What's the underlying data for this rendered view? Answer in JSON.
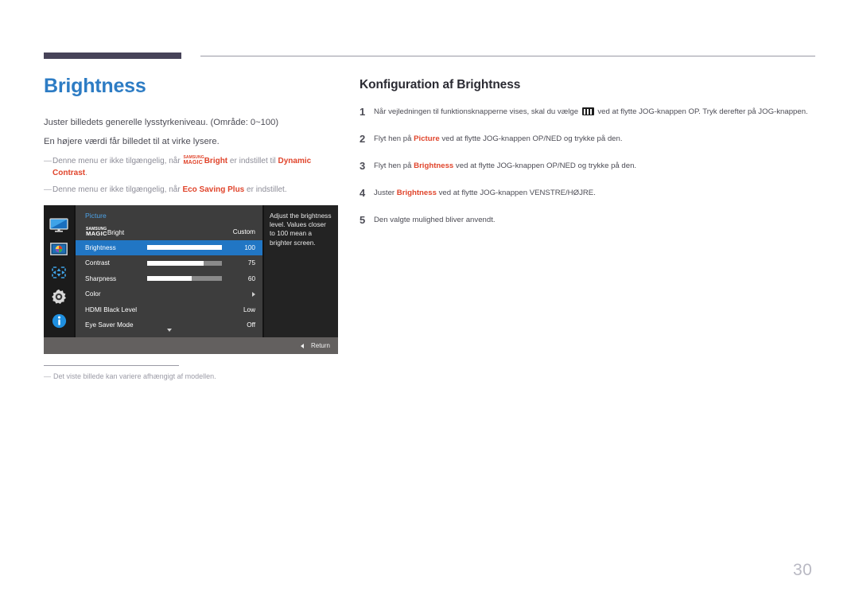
{
  "page": {
    "number": "30"
  },
  "left": {
    "title": "Brightness",
    "intro_lines": [
      "Juster billedets generelle lysstyrkeniveau. (Område: 0~100)",
      "En højere værdi får billedet til at virke lysere."
    ],
    "notes": [
      {
        "dash": "―",
        "prefix": "Denne menu er ikke tilgængelig, når ",
        "logo_line1": "SAMSUNG",
        "logo_line2": "MAGIC",
        "logo_suffix": "Bright",
        "middle": " er indstillet til ",
        "keyword": "Dynamic Contrast",
        "suffix": "."
      },
      {
        "dash": "―",
        "prefix": "Denne menu er ikke tilgængelig, når ",
        "keyword": "Eco Saving Plus",
        "suffix": " er indstillet."
      }
    ],
    "footnote": {
      "dash": "―",
      "text": "Det viste billede kan variere afhængigt af modellen."
    }
  },
  "osd": {
    "panel_title": "Picture",
    "sidebar_icons": [
      "monitor-icon",
      "picture-icon",
      "move-arrows-icon",
      "gear-icon",
      "info-icon"
    ],
    "rows": [
      {
        "label_logo_line1": "SAMSUNG",
        "label_logo_line2": "MAGIC",
        "label": "Bright",
        "value": "Custom",
        "type": "value",
        "selected": false
      },
      {
        "label": "Brightness",
        "value": "100",
        "type": "slider",
        "fill": 100,
        "selected": true
      },
      {
        "label": "Contrast",
        "value": "75",
        "type": "slider",
        "fill": 75,
        "selected": false
      },
      {
        "label": "Sharpness",
        "value": "60",
        "type": "slider",
        "fill": 60,
        "selected": false
      },
      {
        "label": "Color",
        "value": "",
        "type": "submenu",
        "selected": false
      },
      {
        "label": "HDMI Black Level",
        "value": "Low",
        "type": "value",
        "selected": false
      },
      {
        "label": "Eye Saver Mode",
        "value": "Off",
        "type": "value",
        "selected": false
      }
    ],
    "help_text": "Adjust the brightness level. Values closer to 100 mean a brighter screen.",
    "return_label": "Return"
  },
  "right": {
    "section_title": "Konfiguration af Brightness",
    "steps": [
      {
        "num": "1",
        "part1": "Når vejledningen til funktionsknapperne vises, skal du vælge ",
        "icon": "menu-bars-icon",
        "part2": " ved at flytte JOG-knappen OP. Tryk derefter på JOG-knappen."
      },
      {
        "num": "2",
        "part1": "Flyt hen på ",
        "keyword": "Picture",
        "part2": " ved at flytte JOG-knappen OP/NED og trykke på den."
      },
      {
        "num": "3",
        "part1": "Flyt hen på ",
        "keyword": "Brightness",
        "part2": " ved at flytte JOG-knappen OP/NED og trykke på den."
      },
      {
        "num": "4",
        "part1": "Juster ",
        "keyword": "Brightness",
        "part2": " ved at flytte JOG-knappen VENSTRE/HØJRE."
      },
      {
        "num": "5",
        "part1": "Den valgte mulighed bliver anvendt.",
        "keyword": "",
        "part2": ""
      }
    ]
  },
  "colors": {
    "title_blue": "#2d7cc4",
    "keyword_red": "#e0442b",
    "rule_dark": "#474359",
    "osd_selected": "#2176c4"
  }
}
